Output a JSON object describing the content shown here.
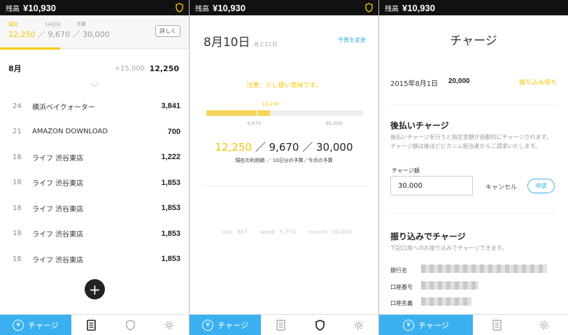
{
  "topbar": {
    "label": "残高",
    "balance": "¥10,930"
  },
  "tabbar": {
    "charge_label": "チャージ",
    "charge_icon": "yen-circle-icon",
    "icons": [
      "document-icon",
      "shield-icon",
      "gear-icon"
    ]
  },
  "colors": {
    "accent_yellow": "#f5c400",
    "accent_blue": "#3ab0f0",
    "dark": "#111111"
  },
  "transactions_screen": {
    "labels": {
      "current": "現在",
      "days": "14日分",
      "budget": "予算"
    },
    "current": "12,250",
    "days_budget": "9,670",
    "budget": "30,000",
    "detail_button": "詳しく",
    "progress_fraction": 0.32,
    "month": {
      "label": "8月",
      "delta": "+15,000",
      "total": "12,250"
    },
    "transactions": [
      {
        "day": "24",
        "name": "横浜ベイクォーター",
        "amount": "3,841"
      },
      {
        "day": "21",
        "name": "AMAZON DOWNLOAD",
        "amount": "700"
      },
      {
        "day": "18",
        "name": "ライフ 渋谷東店",
        "amount": "1,222"
      },
      {
        "day": "18",
        "name": "ライフ 渋谷東店",
        "amount": "1,853"
      },
      {
        "day": "18",
        "name": "ライフ 渋谷東店",
        "amount": "1,853"
      },
      {
        "day": "18",
        "name": "ライフ 渋谷東店",
        "amount": "1,853"
      },
      {
        "day": "18",
        "name": "ライフ 渋谷東店",
        "amount": "1,853"
      }
    ],
    "add_button": "+"
  },
  "budget_screen": {
    "date": "8月10日",
    "remaining": "あと21日",
    "change_budget": "予算を変更",
    "warning": "注意：少し使い気味です。",
    "bar": {
      "current_label": "12,250",
      "mid_label": "9,670",
      "max_label": "30,000",
      "current_fraction": 0.408,
      "mid_fraction": 0.322
    },
    "big": {
      "current": "12,250",
      "sep1": " ／ ",
      "days": "9,670",
      "sep2": " ／ ",
      "month": "30,000"
    },
    "caption": "現在の利用額 ／ 10日分の予算／今月の予算",
    "stats": "day: 967    week: 6,774    month: 30,000"
  },
  "charge_screen": {
    "title": "チャージ",
    "history": {
      "date": "2015年8月1日",
      "amount": "20,000",
      "status": "振り込み待ち"
    },
    "deferred": {
      "heading": "後払いチャージ",
      "description": "後払いチャージを行うと指定金額が自動的にチャージされます。チャージ額は後ほどピカンム担当者からご請求いたします。",
      "amount_label": "チャージ額",
      "amount_value": "30,000",
      "cancel": "キャンセル",
      "apply": "申請"
    },
    "transfer": {
      "heading": "振り込みでチャージ",
      "description": "下記口座へのお振り込みでチャージできます。",
      "bank_name_label": "銀行名",
      "account_number_label": "口座番号",
      "account_name_label": "口座名義"
    }
  }
}
